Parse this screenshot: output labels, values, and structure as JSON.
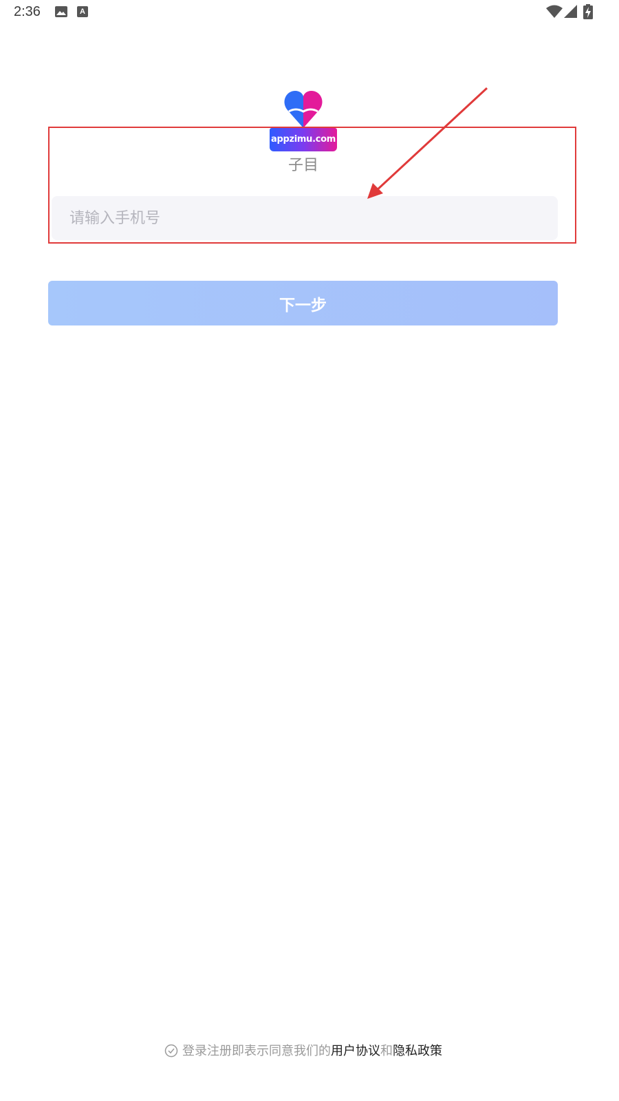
{
  "status_bar": {
    "time": "2:36",
    "left_icons": [
      "image-icon",
      "a-notification-icon"
    ],
    "right_icons": [
      "wifi-icon",
      "signal-icon",
      "battery-charging-icon"
    ]
  },
  "logo": {
    "banner_text": "appzimu.com",
    "heart_colors": [
      "#2f6df6",
      "#e31a9a"
    ]
  },
  "app_name": "子目",
  "phone_input": {
    "value": "",
    "placeholder": "请输入手机号"
  },
  "next_button": {
    "label": "下一步"
  },
  "agreement": {
    "prefix": "登录注册即表示同意我们的",
    "user_agreement_link": "用户协议",
    "conjunction": "和",
    "privacy_policy_link": "隐私政策"
  },
  "colors": {
    "annotation": "#e03a3a",
    "button_bg": "#a6c7fb",
    "input_bg": "#f5f5f9"
  }
}
